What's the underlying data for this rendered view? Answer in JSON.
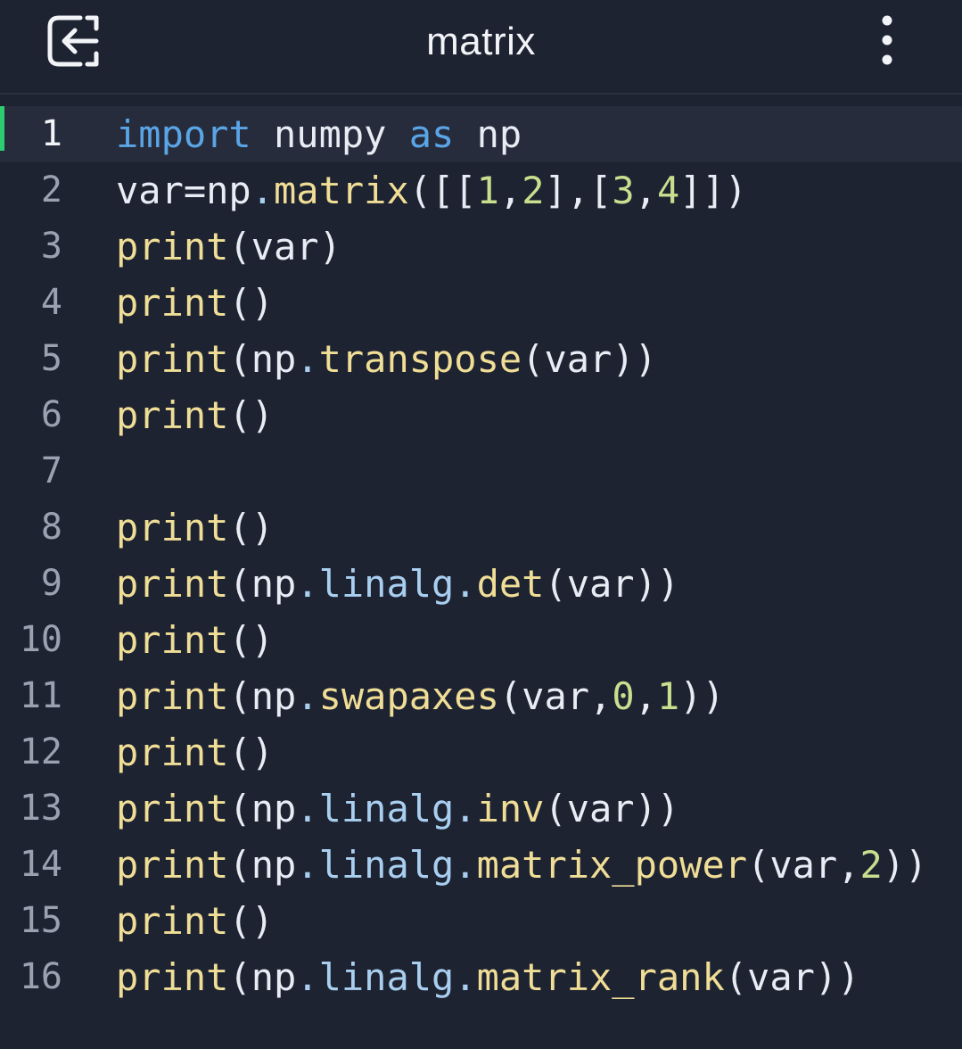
{
  "header": {
    "title": "matrix",
    "back_icon": "exit-arrow-icon",
    "menu_icon": "more-vertical-icon"
  },
  "colors": {
    "background": "#1e2332",
    "active_line": "#262c3c",
    "active_marker": "#2ecc71",
    "keyword": "#5aa5e6",
    "function": "#f0de96",
    "number": "#c8df8e",
    "attribute": "#a9cff0",
    "text": "#e8ecf4"
  },
  "editor": {
    "active_line": 1,
    "lines": [
      {
        "num": "1",
        "tokens": [
          {
            "t": "kw",
            "v": "import"
          },
          {
            "t": "plain",
            "v": " numpy "
          },
          {
            "t": "kw",
            "v": "as"
          },
          {
            "t": "plain",
            "v": " np"
          }
        ]
      },
      {
        "num": "2",
        "tokens": [
          {
            "t": "plain",
            "v": "var=np"
          },
          {
            "t": "attr",
            "v": "."
          },
          {
            "t": "fn",
            "v": "matrix"
          },
          {
            "t": "plain",
            "v": "([["
          },
          {
            "t": "num",
            "v": "1"
          },
          {
            "t": "plain",
            "v": ","
          },
          {
            "t": "num",
            "v": "2"
          },
          {
            "t": "plain",
            "v": "],["
          },
          {
            "t": "num",
            "v": "3"
          },
          {
            "t": "plain",
            "v": ","
          },
          {
            "t": "num",
            "v": "4"
          },
          {
            "t": "plain",
            "v": "]])"
          }
        ]
      },
      {
        "num": "3",
        "tokens": [
          {
            "t": "fn",
            "v": "print"
          },
          {
            "t": "plain",
            "v": "(var)"
          }
        ]
      },
      {
        "num": "4",
        "tokens": [
          {
            "t": "fn",
            "v": "print"
          },
          {
            "t": "plain",
            "v": "()"
          }
        ]
      },
      {
        "num": "5",
        "tokens": [
          {
            "t": "fn",
            "v": "print"
          },
          {
            "t": "plain",
            "v": "(np"
          },
          {
            "t": "attr",
            "v": "."
          },
          {
            "t": "fn",
            "v": "transpose"
          },
          {
            "t": "plain",
            "v": "(var))"
          }
        ]
      },
      {
        "num": "6",
        "tokens": [
          {
            "t": "fn",
            "v": "print"
          },
          {
            "t": "plain",
            "v": "()"
          }
        ]
      },
      {
        "num": "7",
        "tokens": []
      },
      {
        "num": "8",
        "tokens": [
          {
            "t": "fn",
            "v": "print"
          },
          {
            "t": "plain",
            "v": "()"
          }
        ]
      },
      {
        "num": "9",
        "tokens": [
          {
            "t": "fn",
            "v": "print"
          },
          {
            "t": "plain",
            "v": "(np"
          },
          {
            "t": "attr",
            "v": ".linalg."
          },
          {
            "t": "fn",
            "v": "det"
          },
          {
            "t": "plain",
            "v": "(var))"
          }
        ]
      },
      {
        "num": "10",
        "tokens": [
          {
            "t": "fn",
            "v": "print"
          },
          {
            "t": "plain",
            "v": "()"
          }
        ]
      },
      {
        "num": "11",
        "tokens": [
          {
            "t": "fn",
            "v": "print"
          },
          {
            "t": "plain",
            "v": "(np"
          },
          {
            "t": "attr",
            "v": "."
          },
          {
            "t": "fn",
            "v": "swapaxes"
          },
          {
            "t": "plain",
            "v": "(var,"
          },
          {
            "t": "num",
            "v": "0"
          },
          {
            "t": "plain",
            "v": ","
          },
          {
            "t": "num",
            "v": "1"
          },
          {
            "t": "plain",
            "v": "))"
          }
        ]
      },
      {
        "num": "12",
        "tokens": [
          {
            "t": "fn",
            "v": "print"
          },
          {
            "t": "plain",
            "v": "()"
          }
        ]
      },
      {
        "num": "13",
        "tokens": [
          {
            "t": "fn",
            "v": "print"
          },
          {
            "t": "plain",
            "v": "(np"
          },
          {
            "t": "attr",
            "v": ".linalg."
          },
          {
            "t": "fn",
            "v": "inv"
          },
          {
            "t": "plain",
            "v": "(var))"
          }
        ]
      },
      {
        "num": "14",
        "tokens": [
          {
            "t": "fn",
            "v": "print"
          },
          {
            "t": "plain",
            "v": "(np"
          },
          {
            "t": "attr",
            "v": ".linalg."
          },
          {
            "t": "fn",
            "v": "matrix_power"
          },
          {
            "t": "plain",
            "v": "(var,"
          },
          {
            "t": "num",
            "v": "2"
          },
          {
            "t": "plain",
            "v": "))"
          }
        ]
      },
      {
        "num": "15",
        "tokens": [
          {
            "t": "fn",
            "v": "print"
          },
          {
            "t": "plain",
            "v": "()"
          }
        ]
      },
      {
        "num": "16",
        "tokens": [
          {
            "t": "fn",
            "v": "print"
          },
          {
            "t": "plain",
            "v": "(np"
          },
          {
            "t": "attr",
            "v": ".linalg."
          },
          {
            "t": "fn",
            "v": "matrix_rank"
          },
          {
            "t": "plain",
            "v": "(var))"
          }
        ]
      }
    ]
  }
}
